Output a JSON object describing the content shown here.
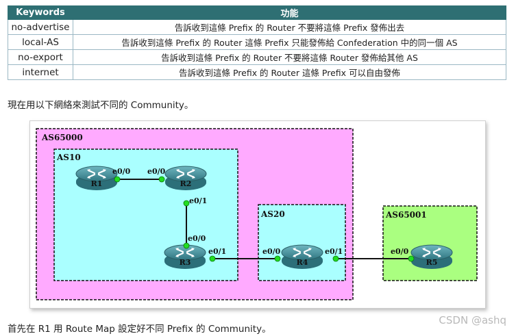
{
  "table": {
    "headers": [
      "Keywords",
      "功能"
    ],
    "rows": [
      {
        "keyword": "no-advertise",
        "desc": "告訴收到這條 Prefix 的 Router 不要將這條 Prefix 發佈出去"
      },
      {
        "keyword": "local-AS",
        "desc": "告訴收到這條 Prefix 的 Router 這條 Prefix 只能發佈給 Confederation 中的同一個 AS"
      },
      {
        "keyword": "no-export",
        "desc": "告訴收到這條 Prefix 的 Router 不要將這條 Router 發佈給其他 AS"
      },
      {
        "keyword": "internet",
        "desc": "告訴收到這條 Prefix 的 Router 這條 Prefix 可以自由發佈"
      }
    ]
  },
  "text": {
    "intro": "現在用以下網絡來測試不同的 Community。",
    "footer": "首先在 R1 用 Route Map 設定好不同 Prefix 的 Community。",
    "watermark": "CSDN @ashq"
  },
  "diagram": {
    "as_labels": {
      "as65000": "AS65000",
      "as10": "AS10",
      "as20": "AS20",
      "as65001": "AS65001"
    },
    "routers": {
      "r1": "R1",
      "r2": "R2",
      "r3": "R3",
      "r4": "R4",
      "r5": "R5"
    },
    "ports": {
      "r1_e00": "e0/0",
      "r2_e00": "e0/0",
      "r2_e01": "e0/1",
      "r3_e00": "e0/0",
      "r3_e01": "e0/1",
      "r4_e00": "e0/0",
      "r4_e01": "e0/1",
      "r5_e00": "e0/0"
    },
    "colors": {
      "as65000": "#ffaaff",
      "as10": "#aaffff",
      "as20": "#aaffff",
      "as65001": "#aaff80",
      "port": "#22dd22",
      "router_body": "#3f8f9a"
    }
  }
}
